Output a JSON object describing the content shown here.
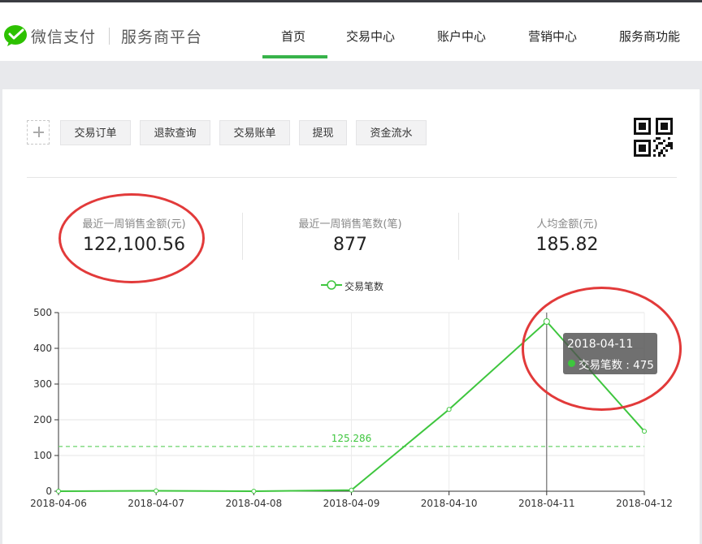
{
  "header": {
    "brand": "微信支付",
    "subtitle": "服务商平台",
    "nav": [
      {
        "label": "首页",
        "active": true
      },
      {
        "label": "交易中心",
        "active": false
      },
      {
        "label": "账户中心",
        "active": false
      },
      {
        "label": "营销中心",
        "active": false
      },
      {
        "label": "服务商功能",
        "active": false
      }
    ],
    "accent_color": "#37b34a"
  },
  "quick_actions": {
    "add_icon": "plus-icon",
    "buttons": [
      "交易订单",
      "退款查询",
      "交易账单",
      "提现",
      "资金流水"
    ],
    "qr_icon": "qr-code-icon"
  },
  "stats": [
    {
      "label": "最近一周销售金额(元)",
      "value": "122,100.56"
    },
    {
      "label": "最近一周销售笔数(笔)",
      "value": "877"
    },
    {
      "label": "人均金额(元)",
      "value": "185.82"
    }
  ],
  "tooltip": {
    "date": "2018-04-11",
    "series": "交易笔数",
    "value": "475",
    "text": "交易笔数 : 475"
  },
  "chart_data": {
    "type": "line",
    "legend": [
      "交易笔数"
    ],
    "legend_position": "top-center",
    "categories": [
      "2018-04-06",
      "2018-04-07",
      "2018-04-08",
      "2018-04-09",
      "2018-04-10",
      "2018-04-11",
      "2018-04-12"
    ],
    "series": [
      {
        "name": "交易笔数",
        "values": [
          0,
          1,
          0,
          3,
          229,
          475,
          168
        ],
        "color": "#3ec63e"
      }
    ],
    "average_line": {
      "value": 125.286,
      "label": "125.286",
      "color": "#6bd36b"
    },
    "ylim": [
      0,
      500
    ],
    "yticks": [
      0,
      100,
      200,
      300,
      400,
      500
    ],
    "grid": true,
    "highlight_category": "2018-04-11"
  }
}
